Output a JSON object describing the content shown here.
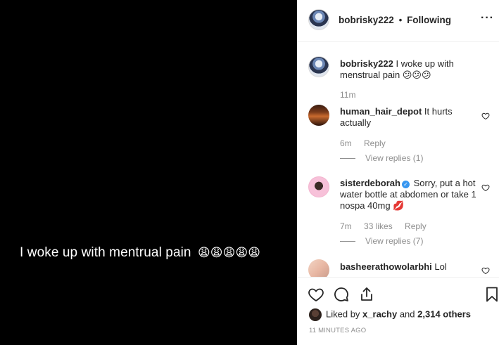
{
  "post": {
    "media_caption": "I woke up with mentrual pain",
    "media_emojis": "😩😩😩😩😩"
  },
  "header": {
    "username": "bobrisky222",
    "separator": "•",
    "follow_status": "Following",
    "more_icon": "more-horizontal-icon"
  },
  "caption": {
    "username": "bobrisky222",
    "text": "I woke up with menstrual pain 😕😕😕",
    "time": "11m"
  },
  "comments": [
    {
      "username": "human_hair_depot",
      "text": "It hurts actually",
      "time": "6m",
      "reply_label": "Reply",
      "view_replies": "View replies (1)"
    },
    {
      "username": "sisterdeborah",
      "verified": true,
      "text": "Sorry, put a hot water bottle at abdomen or take 1 nospa 40mg 💋",
      "time": "7m",
      "likes": "33 likes",
      "reply_label": "Reply",
      "view_replies": "View replies (7)"
    },
    {
      "username": "basheerathowolarbhi",
      "text": "Lol"
    }
  ],
  "actions": {
    "liked_prefix": "Liked by",
    "liked_user": "x_rachy",
    "liked_and": "and",
    "liked_count": "2,314 others",
    "timestamp": "11 MINUTES AGO"
  }
}
